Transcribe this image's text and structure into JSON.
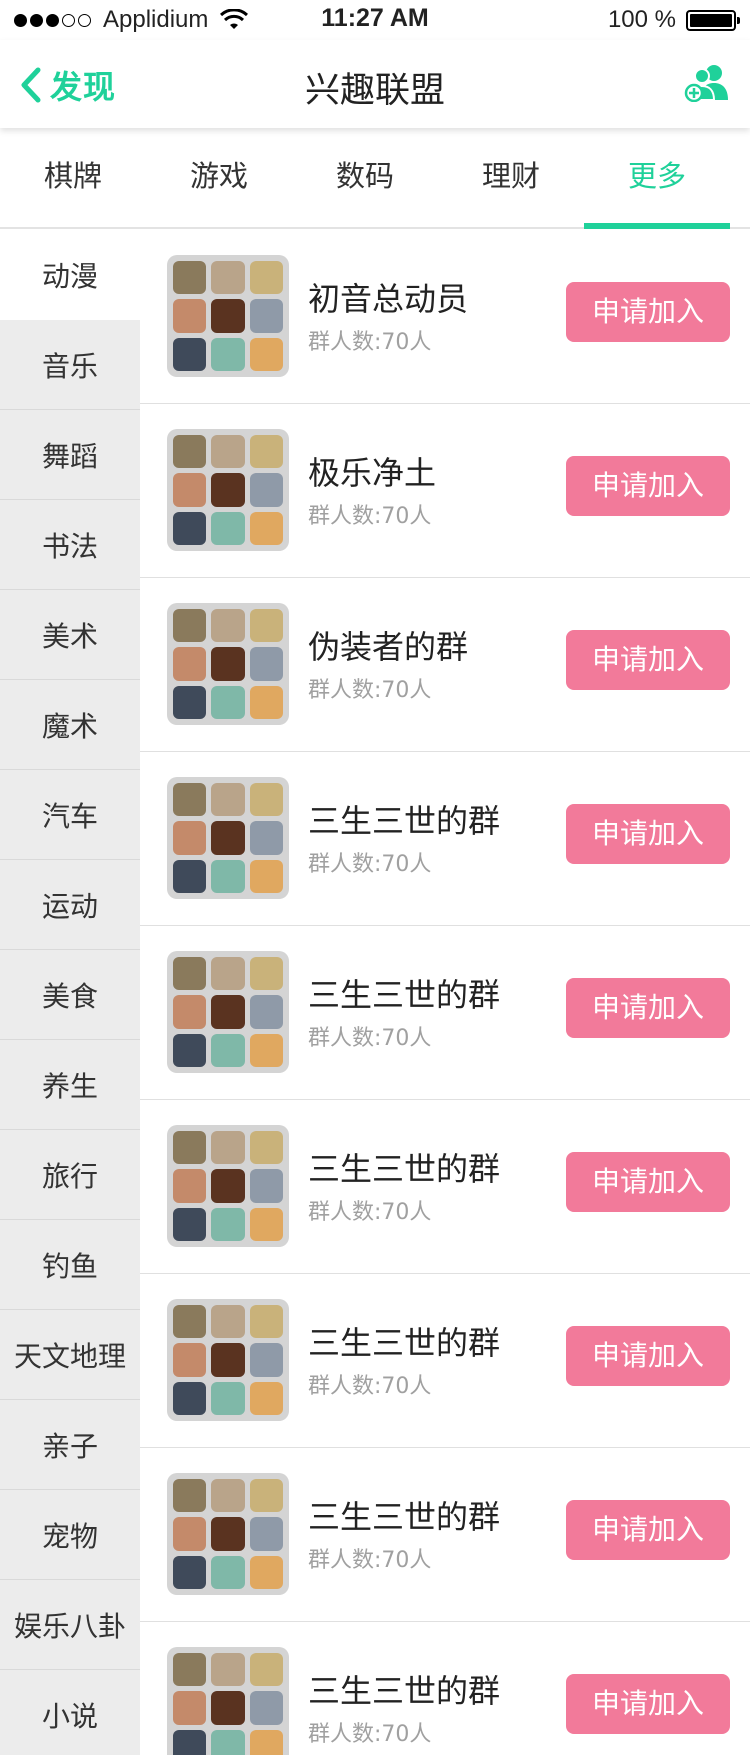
{
  "status_bar": {
    "carrier": "Applidium",
    "time": "11:27 AM",
    "battery": "100 %",
    "signal_icon": "signal-dots-icon",
    "wifi_icon": "wifi-icon",
    "battery_icon": "battery-full-icon"
  },
  "nav": {
    "back_label": "发现",
    "back_icon": "chevron-left-icon",
    "title": "兴趣联盟",
    "action_icon": "add-group-icon"
  },
  "tabs": [
    {
      "label": "棋牌"
    },
    {
      "label": "游戏"
    },
    {
      "label": "数码"
    },
    {
      "label": "理财"
    },
    {
      "label": "更多",
      "active": true
    }
  ],
  "categories": [
    {
      "label": "动漫",
      "active": true
    },
    {
      "label": "音乐"
    },
    {
      "label": "舞蹈"
    },
    {
      "label": "书法"
    },
    {
      "label": "美术"
    },
    {
      "label": "魔术"
    },
    {
      "label": "汽车"
    },
    {
      "label": "运动"
    },
    {
      "label": "美食"
    },
    {
      "label": "养生"
    },
    {
      "label": "旅行"
    },
    {
      "label": "钓鱼"
    },
    {
      "label": "天文地理"
    },
    {
      "label": "亲子"
    },
    {
      "label": "宠物"
    },
    {
      "label": "娱乐八卦"
    },
    {
      "label": "小说"
    }
  ],
  "groups": [
    {
      "name": "初音总动员",
      "count": "群人数:70人",
      "join_label": "申请加入"
    },
    {
      "name": "极乐净土",
      "count": "群人数:70人",
      "join_label": "申请加入"
    },
    {
      "name": "伪装者的群",
      "count": "群人数:70人",
      "join_label": "申请加入"
    },
    {
      "name": "三生三世的群",
      "count": "群人数:70人",
      "join_label": "申请加入"
    },
    {
      "name": "三生三世的群",
      "count": "群人数:70人",
      "join_label": "申请加入"
    },
    {
      "name": "三生三世的群",
      "count": "群人数:70人",
      "join_label": "申请加入"
    },
    {
      "name": "三生三世的群",
      "count": "群人数:70人",
      "join_label": "申请加入"
    },
    {
      "name": "三生三世的群",
      "count": "群人数:70人",
      "join_label": "申请加入"
    },
    {
      "name": "三生三世的群",
      "count": "群人数:70人",
      "join_label": "申请加入"
    }
  ],
  "colors": {
    "accent": "#1fd19a",
    "join_button": "#f27a9a",
    "sidebar_bg": "#ececec"
  },
  "avatar_tiles": [
    "#8a7a5c",
    "#b9a48a",
    "#c9b27a",
    "#c48a6a",
    "#5a3320",
    "#8f9aa8",
    "#3f4a5a",
    "#7fb8a8",
    "#e0a860"
  ]
}
